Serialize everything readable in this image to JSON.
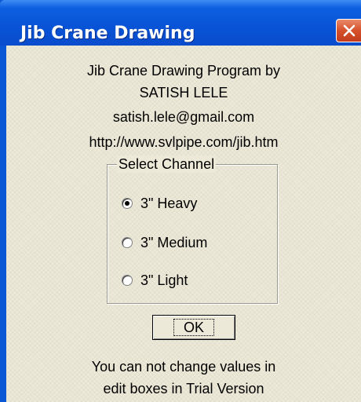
{
  "window": {
    "title": "Jib Crane Drawing"
  },
  "info": {
    "line1": "Jib Crane Drawing Program by",
    "line2": "SATISH LELE",
    "line3": "satish.lele@gmail.com",
    "line4": "http://www.svlpipe.com/jib.htm"
  },
  "channel_group": {
    "label": "Select Channel",
    "options": [
      {
        "label": "3\" Heavy",
        "checked": true
      },
      {
        "label": "3\" Medium",
        "checked": false
      },
      {
        "label": "3\" Light",
        "checked": false
      }
    ]
  },
  "ok_button": {
    "label": "OK"
  },
  "notice": {
    "line1": "You can not change values in",
    "line2": "edit boxes in Trial Version"
  },
  "colors": {
    "titlebar": "#0a57d6",
    "client_bg": "#ece9d8",
    "close_button": "#d6502b"
  }
}
